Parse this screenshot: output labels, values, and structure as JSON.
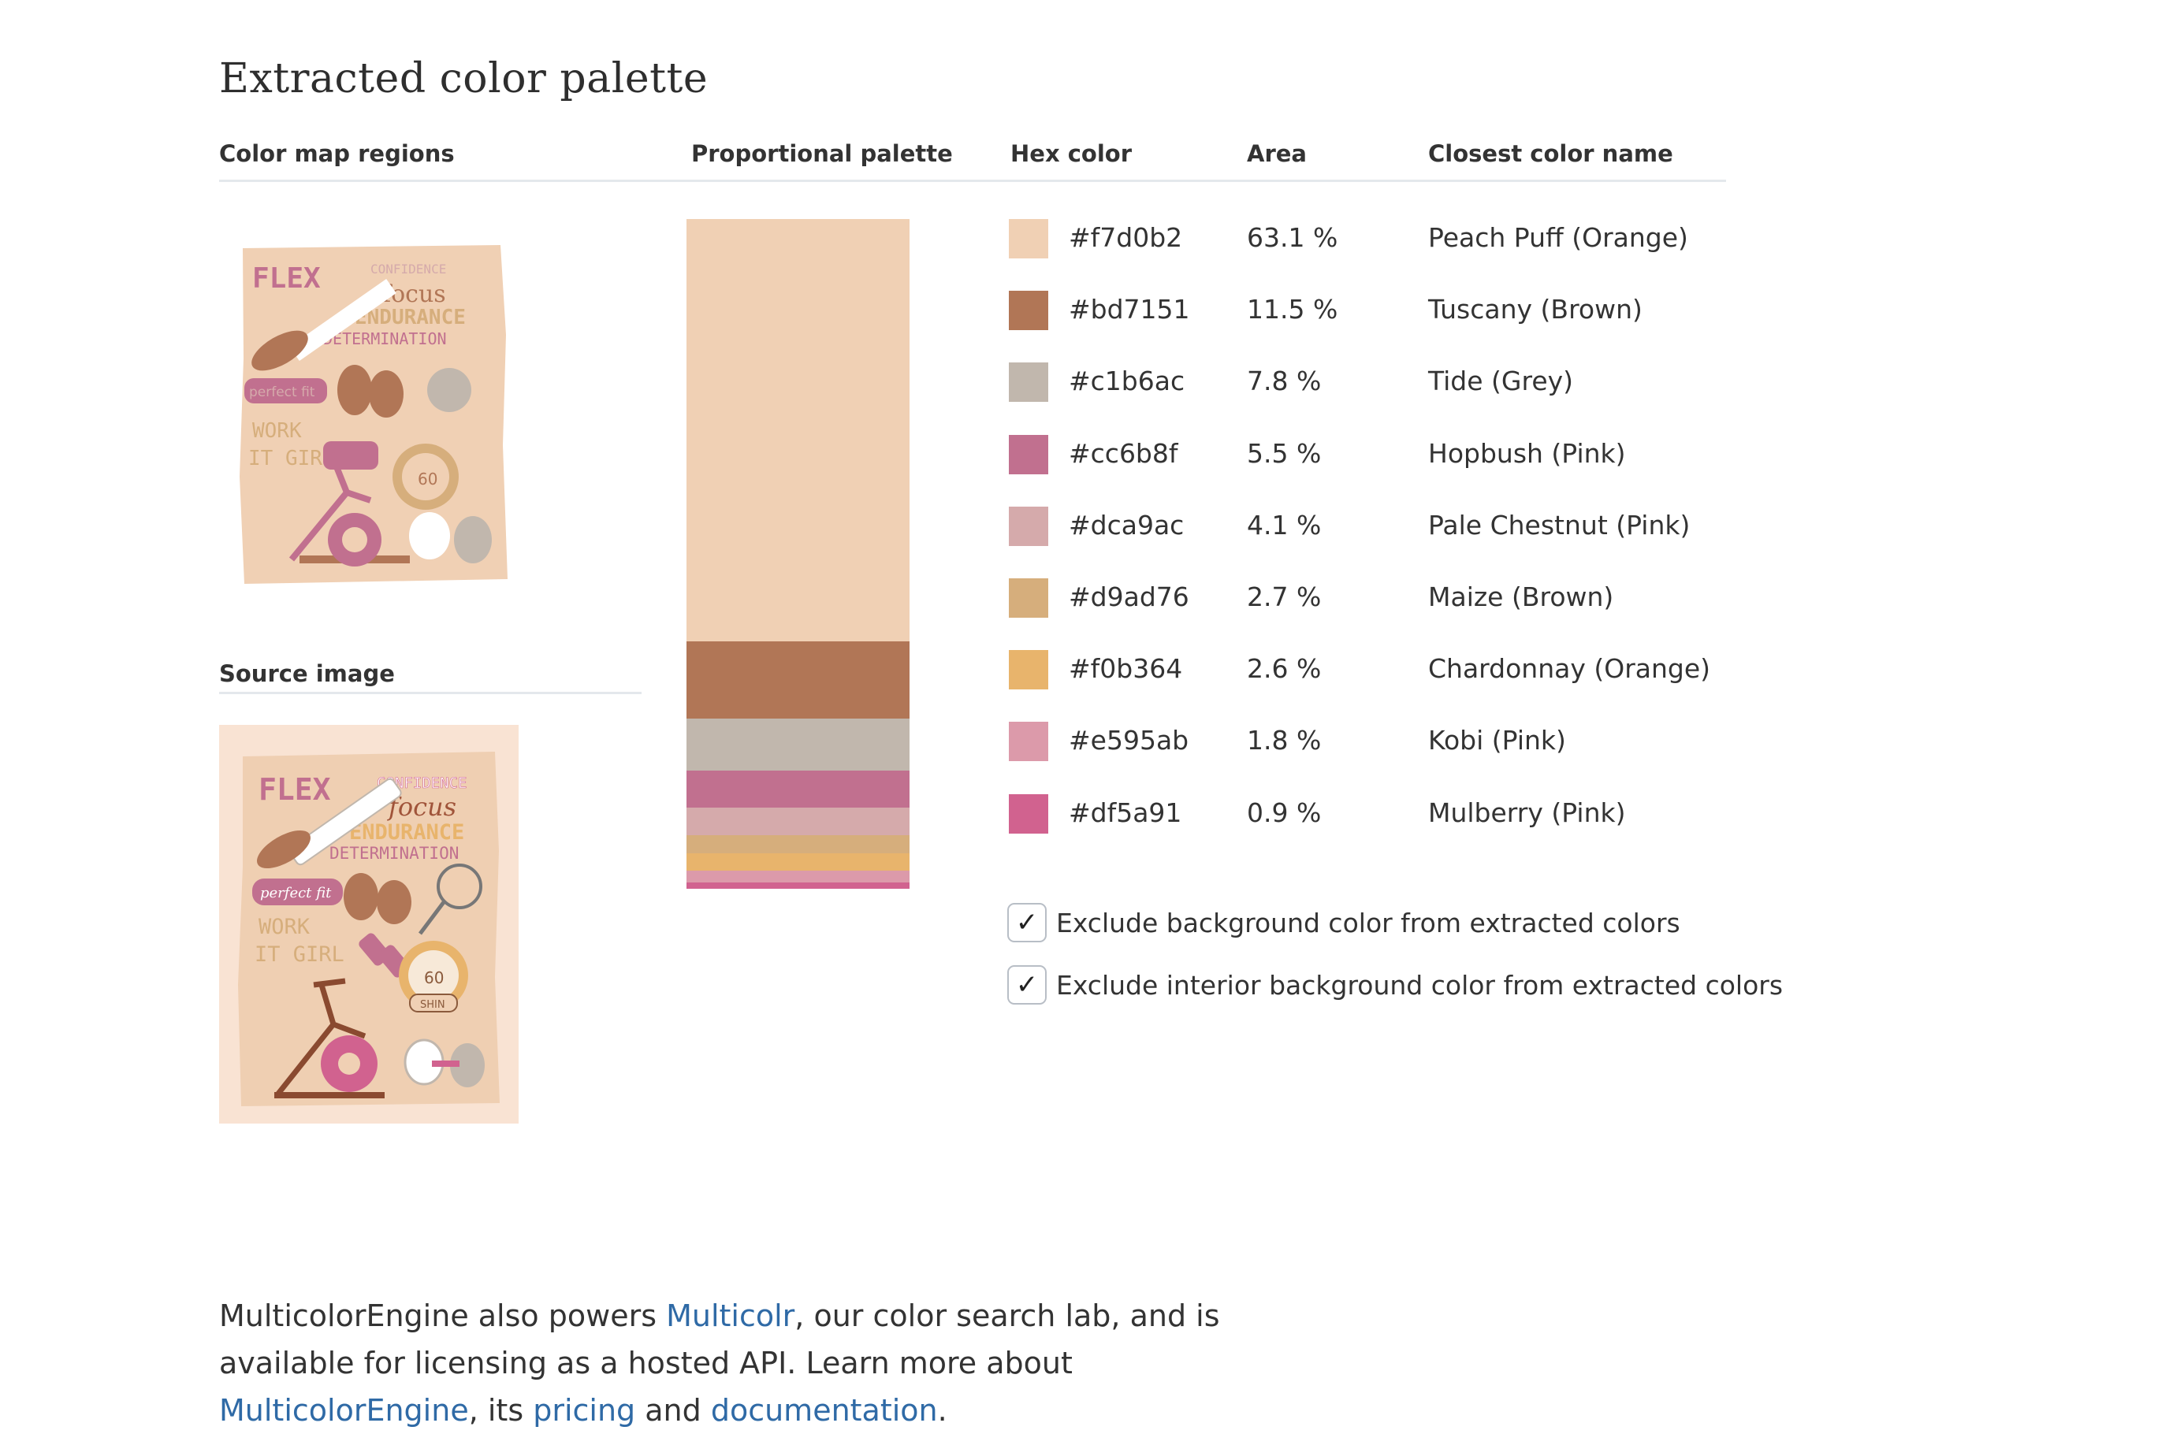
{
  "title": "Extracted color palette",
  "headers": {
    "color_map": "Color map regions",
    "proportional": "Proportional palette",
    "hex": "Hex color",
    "area": "Area",
    "name": "Closest color name",
    "source": "Source image"
  },
  "colors": [
    {
      "hex": "#f7d0b2",
      "area": "63.1 %",
      "area_value": 63.1,
      "name": "Peach Puff (Orange)",
      "swatch": "#f0d0b4"
    },
    {
      "hex": "#bd7151",
      "area": "11.5 %",
      "area_value": 11.5,
      "name": "Tuscany (Brown)",
      "swatch": "#b17656"
    },
    {
      "hex": "#c1b6ac",
      "area": "7.8 %",
      "area_value": 7.8,
      "name": "Tide (Grey)",
      "swatch": "#c1b7ad"
    },
    {
      "hex": "#cc6b8f",
      "area": "5.5 %",
      "area_value": 5.5,
      "name": "Hopbush (Pink)",
      "swatch": "#c1708f"
    },
    {
      "hex": "#dca9ac",
      "area": "4.1 %",
      "area_value": 4.1,
      "name": "Pale Chestnut (Pink)",
      "swatch": "#d5aaab"
    },
    {
      "hex": "#d9ad76",
      "area": "2.7 %",
      "area_value": 2.7,
      "name": "Maize (Brown)",
      "swatch": "#d6ae7c"
    },
    {
      "hex": "#f0b364",
      "area": "2.6 %",
      "area_value": 2.6,
      "name": "Chardonnay (Orange)",
      "swatch": "#e8b46c"
    },
    {
      "hex": "#e595ab",
      "area": "1.8 %",
      "area_value": 1.8,
      "name": "Kobi (Pink)",
      "swatch": "#dc9aaa"
    },
    {
      "hex": "#df5a91",
      "area": "0.9 %",
      "area_value": 0.9,
      "name": "Mulberry (Pink)",
      "swatch": "#d1628f"
    }
  ],
  "options": [
    {
      "label": "Exclude background color from extracted colors",
      "checked": true
    },
    {
      "label": "Exclude interior background color from extracted colors",
      "checked": true
    }
  ],
  "checkmark_glyph": "✓",
  "poster_text": {
    "flex": "FLEX",
    "confidence": "CONFIDENCE",
    "focus": "focus",
    "endurance": "ENDURANCE",
    "determination": "DETERMINATION",
    "perfect_fit": "perfect fit",
    "work": "WORK",
    "it_girl": "IT GIRL",
    "sixty": "60",
    "shiny": "SHIN"
  },
  "paragraph": {
    "t1": "MulticolorEngine also powers ",
    "link1": "Multicolr",
    "t2": ", our color search lab, and is available for licensing as a hosted API. Learn more about ",
    "link2": "MulticolorEngine",
    "t3": ", its ",
    "link3": "pricing",
    "t4": " and ",
    "link4": "documentation",
    "t5": "."
  },
  "link_color": "#2f6aa6"
}
